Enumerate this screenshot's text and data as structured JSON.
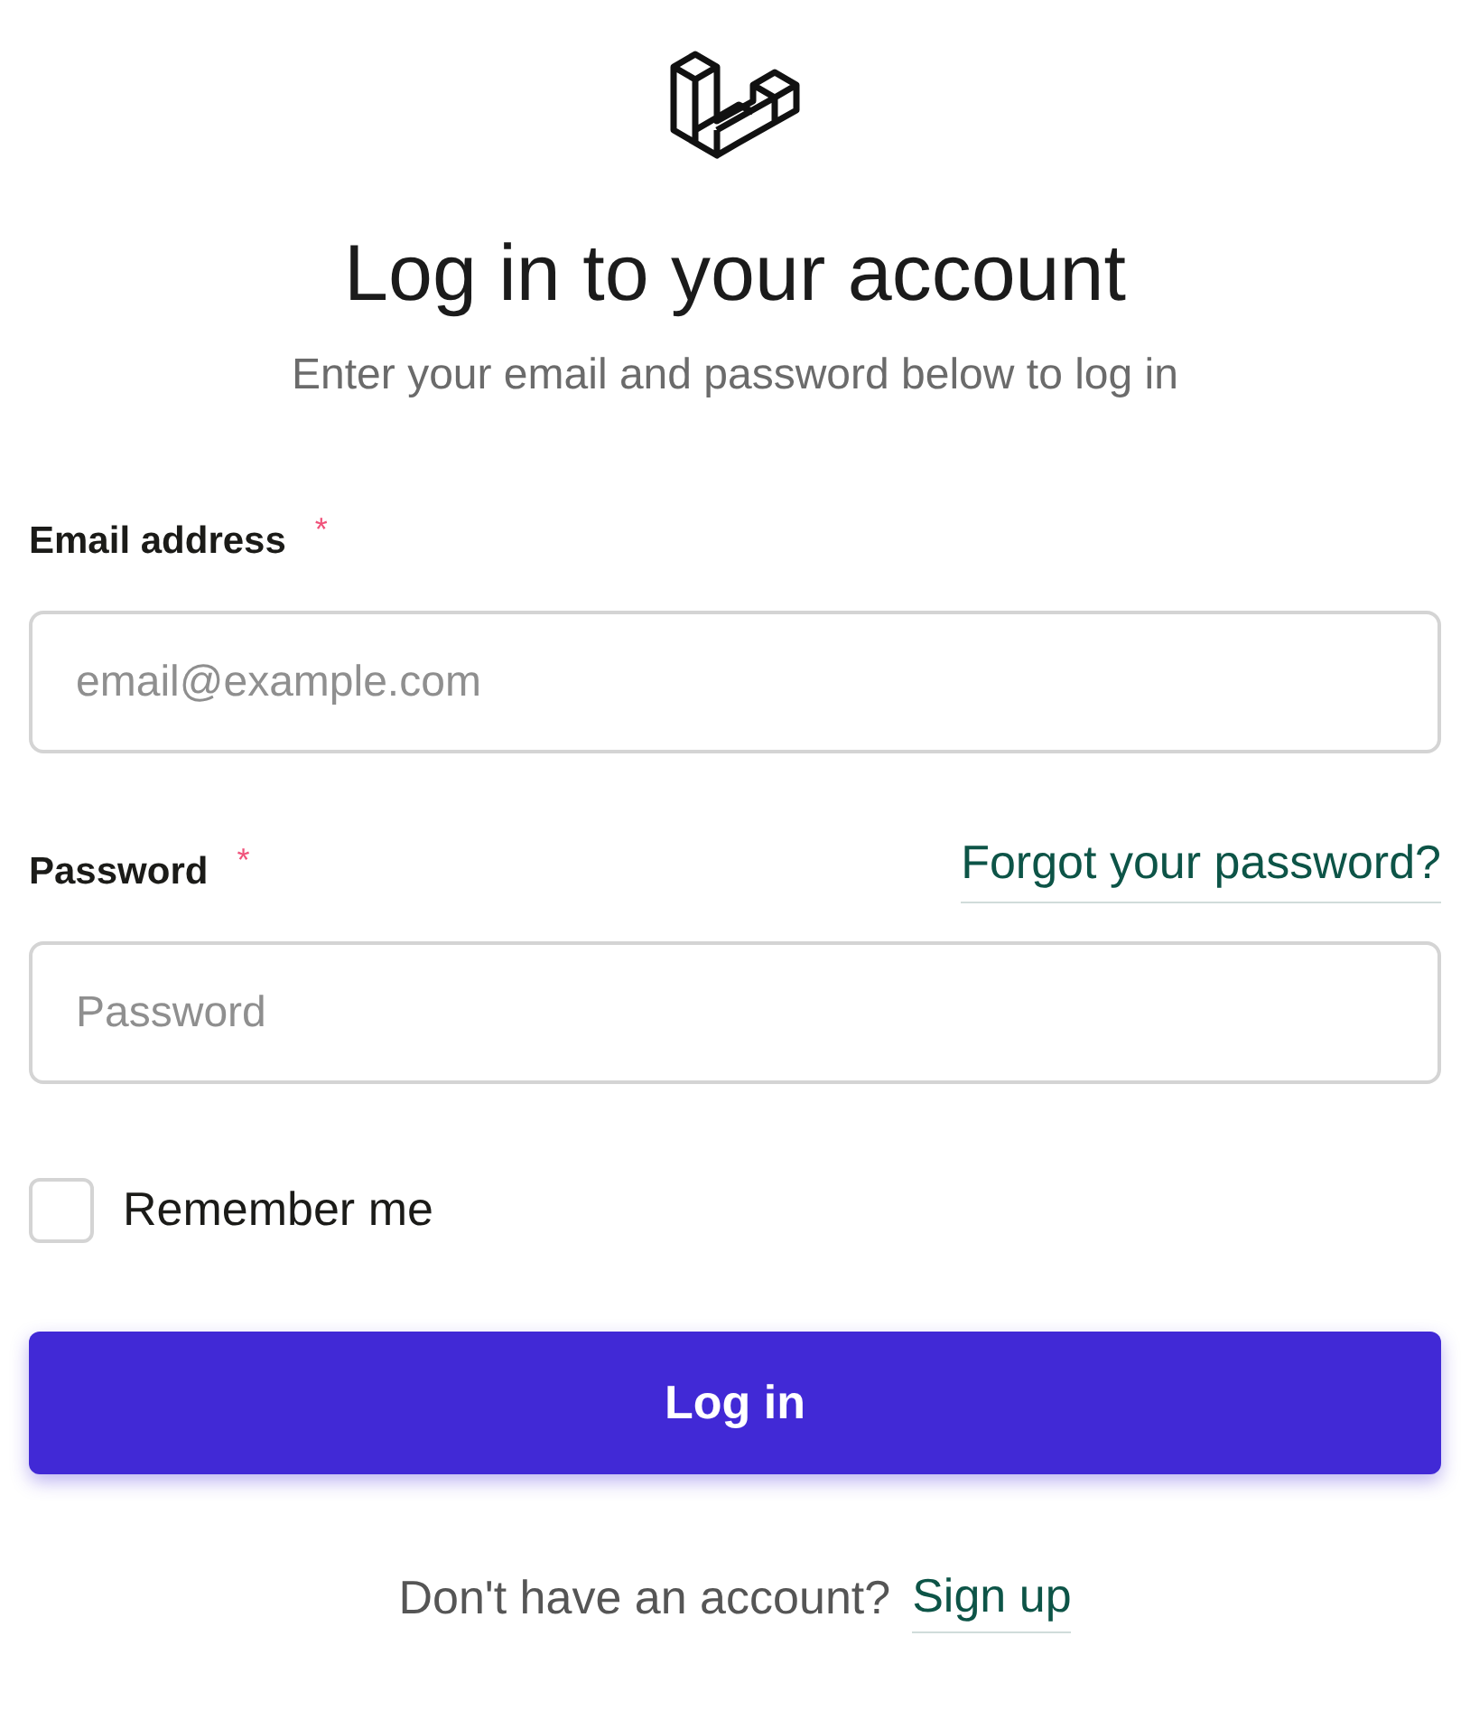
{
  "title": "Log in to your account",
  "subtitle": "Enter your email and password below to log in",
  "fields": [
    {
      "label": "Email address",
      "required_mark": "*",
      "placeholder": "email@example.com"
    },
    {
      "label": "Password",
      "required_mark": "*",
      "placeholder": "Password",
      "link": "Forgot your password?"
    }
  ],
  "remember": {
    "label": "Remember me",
    "checked": false
  },
  "submit": "Log in",
  "footer": {
    "text": "Don't have an account?",
    "link": "Sign up"
  }
}
